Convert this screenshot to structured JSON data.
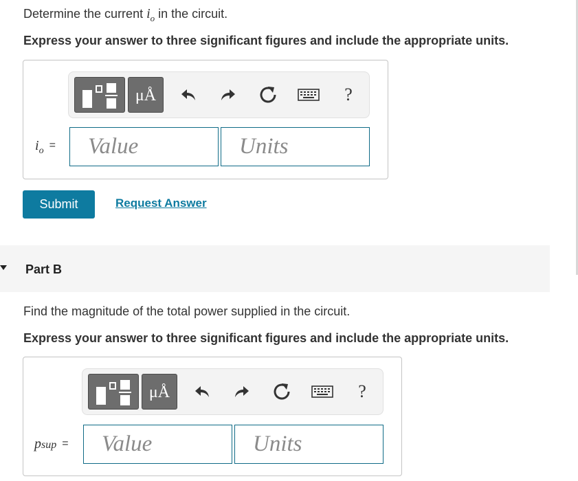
{
  "part_a": {
    "question_prefix": "Determine the current ",
    "question_var": "i",
    "question_var_sub": "o",
    "question_suffix": " in the circuit.",
    "instructions": "Express your answer to three significant figures and include the appropriate units.",
    "variable": "i",
    "variable_sub": "o",
    "equals": "=",
    "value_placeholder": "Value",
    "units_placeholder": "Units",
    "submit_label": "Submit",
    "request_answer_label": "Request Answer"
  },
  "part_b": {
    "title": "Part B",
    "question": "Find the magnitude of the total power supplied in the circuit.",
    "instructions": "Express your answer to three significant figures and include the appropriate units.",
    "variable": "p",
    "variable_sub": "sup",
    "equals": "=",
    "value_placeholder": "Value",
    "units_placeholder": "Units"
  },
  "toolbar": {
    "units_label": "μÅ",
    "help_label": "?",
    "icons": [
      "templates-icon",
      "units-icon",
      "undo-icon",
      "redo-icon",
      "reset-icon",
      "keyboard-icon",
      "help-icon"
    ]
  },
  "colors": {
    "accent": "#0e7ba0",
    "field_border": "#0e6a86",
    "toolbar_button": "#6d6d6d",
    "toolbar_bg": "#f3f3f3",
    "part_header_bg": "#f5f5f5"
  }
}
